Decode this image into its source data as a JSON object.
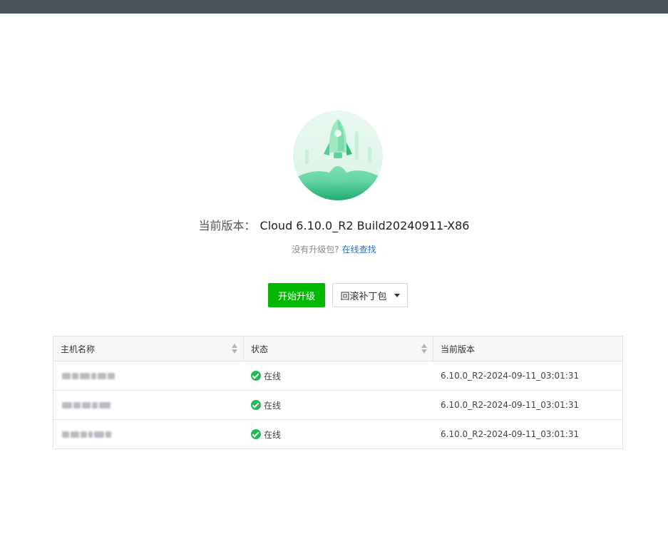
{
  "header": {
    "bar_color": "#4a525b"
  },
  "hero": {
    "icon": "rocket-launch-illustration"
  },
  "version": {
    "label": "当前版本：",
    "value": "Cloud 6.10.0_R2 Build20240911-X86"
  },
  "hint": {
    "text": "没有升级包?",
    "link": "在线查找"
  },
  "actions": {
    "start_upgrade": "开始升级",
    "rollback_patch": "回滚补丁包"
  },
  "table": {
    "columns": [
      "主机名称",
      "状态",
      "当前版本"
    ],
    "rows": [
      {
        "hostname": "",
        "status": "在线",
        "version": "6.10.0_R2-2024-09-11_03:01:31"
      },
      {
        "hostname": "",
        "status": "在线",
        "version": "6.10.0_R2-2024-09-11_03:01:31"
      },
      {
        "hostname": "",
        "status": "在线",
        "version": "6.10.0_R2-2024-09-11_03:01:31"
      }
    ]
  },
  "colors": {
    "primary": "#00b900",
    "link": "#2f6fbf",
    "status_online": "#1fba58"
  }
}
